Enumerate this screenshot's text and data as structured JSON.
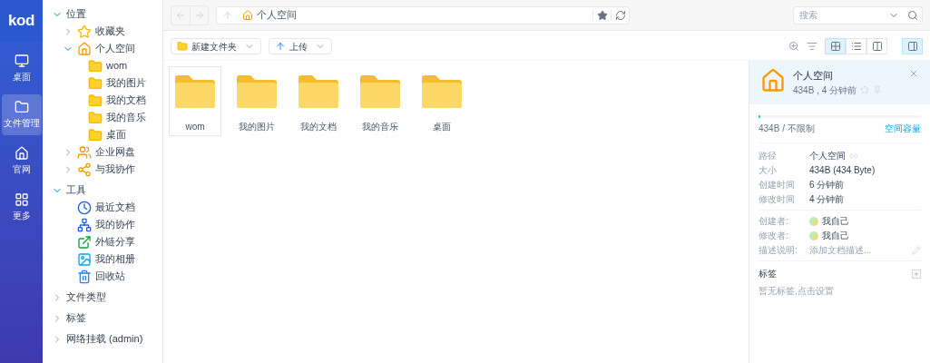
{
  "rail": {
    "logo": "kod",
    "items": [
      {
        "label": "桌面",
        "kind": "desktop",
        "selected": false
      },
      {
        "label": "文件管理",
        "kind": "folder",
        "selected": true
      },
      {
        "label": "官网",
        "kind": "home",
        "selected": false
      },
      {
        "label": "更多",
        "kind": "grid",
        "selected": false
      }
    ]
  },
  "tree": [
    {
      "label": "位置",
      "expanded": true,
      "children": [
        {
          "label": "收藏夹",
          "kind": "star",
          "expanded": false
        },
        {
          "label": "个人空间",
          "kind": "home",
          "expanded": true,
          "children": [
            {
              "label": "wom",
              "kind": "folder"
            },
            {
              "label": "我的图片",
              "kind": "folder"
            },
            {
              "label": "我的文档",
              "kind": "folder"
            },
            {
              "label": "我的音乐",
              "kind": "folder"
            },
            {
              "label": "桌面",
              "kind": "folder"
            }
          ]
        },
        {
          "label": "企业网盘",
          "kind": "group",
          "expanded": false
        },
        {
          "label": "与我协作",
          "kind": "share",
          "expanded": false
        }
      ]
    },
    {
      "label": "工具",
      "expanded": true,
      "children": [
        {
          "label": "最近文档",
          "kind": "clock"
        },
        {
          "label": "我的协作",
          "kind": "nodes"
        },
        {
          "label": "外链分享",
          "kind": "link"
        },
        {
          "label": "我的相册",
          "kind": "album"
        },
        {
          "label": "回收站",
          "kind": "trash"
        }
      ]
    },
    {
      "label": "文件类型",
      "expanded": false
    },
    {
      "label": "标签",
      "expanded": false
    },
    {
      "label": "网络挂载 (admin)",
      "expanded": false
    }
  ],
  "address": {
    "crumb": "个人空间"
  },
  "search": {
    "placeholder": "搜索"
  },
  "toolbar": {
    "new_folder": "新建文件夹",
    "upload": "上传",
    "views": [
      {
        "kind": "icons",
        "selected": true
      },
      {
        "kind": "list",
        "selected": false
      },
      {
        "kind": "split",
        "selected": false
      }
    ],
    "info_panel": {
      "selected": true
    }
  },
  "files": [
    {
      "name": "wom",
      "selected": true
    },
    {
      "name": "我的图片",
      "selected": false
    },
    {
      "name": "我的文档",
      "selected": false
    },
    {
      "name": "我的音乐",
      "selected": false
    },
    {
      "name": "桌面",
      "selected": false
    }
  ],
  "panel": {
    "title": "个人空间",
    "subtitle": "434B , 4 分钟前",
    "quota": "434B / 不限制",
    "quota_link": "空间容量",
    "level": 0.01,
    "props": [
      {
        "key": "路径",
        "value": "个人空间"
      },
      {
        "key": "大小",
        "value": "434B (434 Byte)"
      },
      {
        "key": "创建时间",
        "value": "6 分钟前"
      },
      {
        "key": "修改时间",
        "value": "4 分钟前"
      }
    ],
    "people": [
      {
        "key": "创建者:",
        "value": "我自己"
      },
      {
        "key": "修改者:",
        "value": "我自己"
      }
    ],
    "desc": {
      "key": "描述说明:",
      "placeholder": "添加文档描述..."
    },
    "tags": {
      "title": "标签",
      "empty": "暂无标签,点击设置"
    }
  }
}
